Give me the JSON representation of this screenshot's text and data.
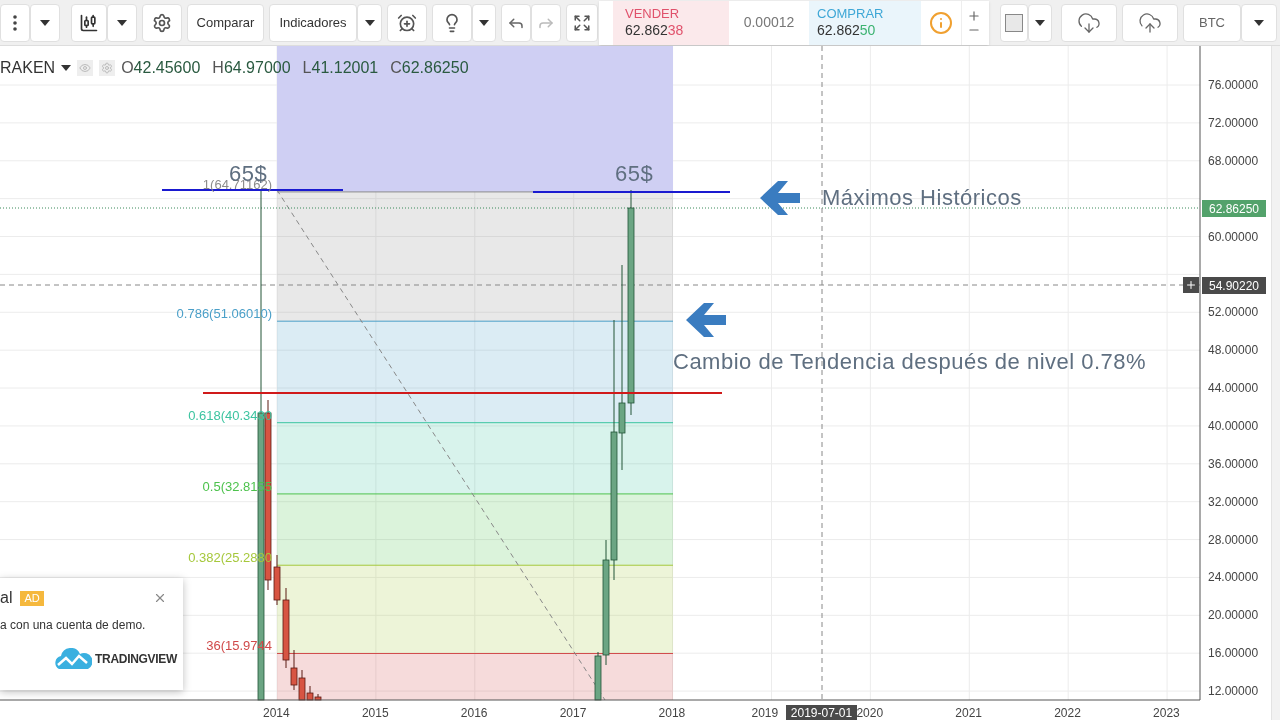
{
  "toolbar": {
    "compare": "Comparar",
    "indicators": "Indicadores",
    "redo": {
      "disabled": true
    },
    "symbol": "BTC"
  },
  "trade_panel": {
    "sell": {
      "label": "VENDER",
      "price": "62.862",
      "price_tail": "38"
    },
    "spread": "0.00012",
    "buy": {
      "label": "COMPRAR",
      "price": "62.862",
      "price_tail": "50"
    }
  },
  "legend": {
    "symbol": "RAKEN",
    "ohlc": [
      {
        "key": "O",
        "value": "42.45600"
      },
      {
        "key": "H",
        "value": "64.97000"
      },
      {
        "key": "L",
        "value": "41.12001"
      },
      {
        "key": "C",
        "value": "62.86250"
      }
    ]
  },
  "fib_levels": [
    {
      "label": "1(64.71162)",
      "color": "#8c8c8c"
    },
    {
      "label": "0.786(51.06010)",
      "color": "#4a9fc8"
    },
    {
      "label": "0.618(40.3430",
      "color": "#3cc4a0"
    },
    {
      "label": "0.5(32.8155",
      "color": "#4dc24d"
    },
    {
      "label": "0.382(25.2880",
      "color": "#a6c83c"
    },
    {
      "label": "36(15.9744",
      "color": "#d04a4a"
    }
  ],
  "annotations": [
    {
      "text": "65$"
    },
    {
      "text": "65$"
    },
    {
      "text": "Máximos Históricos"
    },
    {
      "text": "Cambio de Tendencia después de nivel 0.78%"
    }
  ],
  "price_axis": [
    "76.00000",
    "72.00000",
    "68.00000",
    "60.00000",
    "52.00000",
    "48.00000",
    "44.00000",
    "40.00000",
    "36.00000",
    "32.00000",
    "28.00000",
    "24.00000",
    "20.00000",
    "16.00000",
    "12.00000"
  ],
  "last_price": "62.86250",
  "crosshair_price": "54.90220",
  "time_axis": [
    "2014",
    "2015",
    "2016",
    "2017",
    "2018",
    "2019",
    "2020",
    "2021",
    "2022",
    "2023"
  ],
  "crosshair_date": "2019-07-01",
  "ad_popup": {
    "title": "al",
    "badge": "AD",
    "text": "a con una cuenta de demo.",
    "brand": "TRADINGVIEW"
  }
}
